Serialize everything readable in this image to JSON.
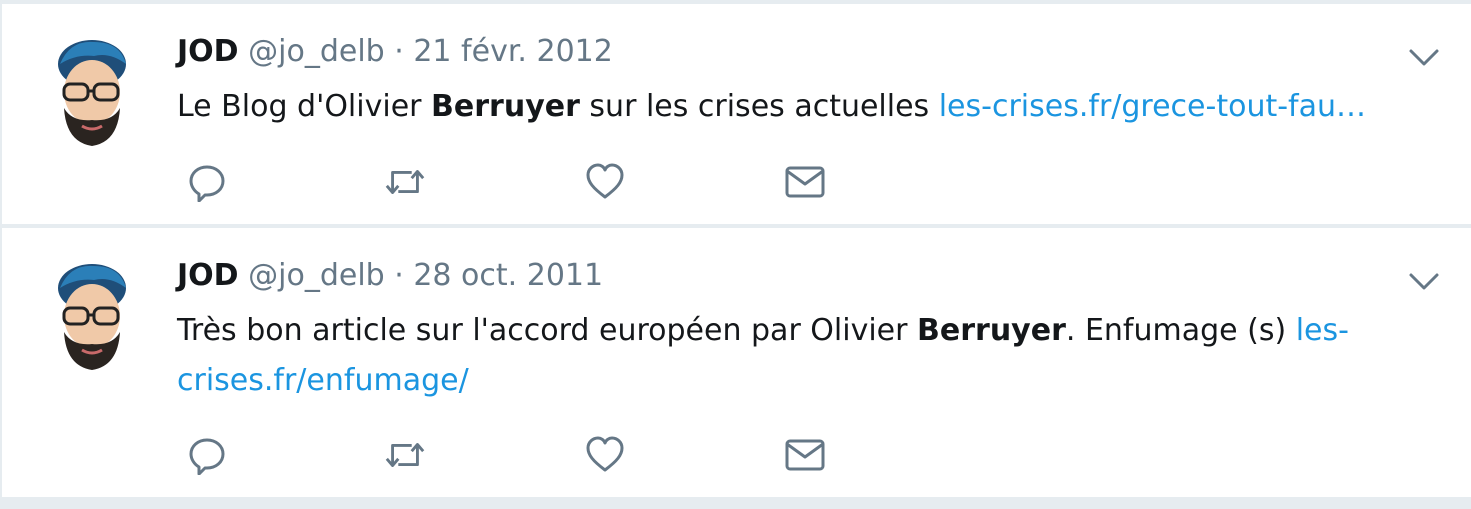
{
  "tweets": [
    {
      "name": "JOD",
      "handle": "@jo_delb",
      "separator": "·",
      "date": "21 févr. 2012",
      "text_before": "Le Blog d'Olivier ",
      "text_bold": "Berruyer",
      "text_after": " sur les crises actuelles ",
      "link": "les-crises.fr/grece-tout-fau…",
      "actions": [
        "reply-icon",
        "retweet-icon",
        "like-icon",
        "direct-message-icon"
      ]
    },
    {
      "name": "JOD",
      "handle": "@jo_delb",
      "separator": "·",
      "date": "28 oct. 2011",
      "text_before": "Très bon article sur l'accord européen par Olivier ",
      "text_bold": "Berruyer",
      "text_after": ".  Enfumage (s) ",
      "link": "les-crises.fr/enfumage/",
      "actions": [
        "reply-icon",
        "retweet-icon",
        "like-icon",
        "direct-message-icon"
      ]
    }
  ],
  "colors": {
    "background": "#e6ecf0",
    "text": "#14171a",
    "muted": "#657786",
    "link": "#1b95e0",
    "icon": "#657786"
  }
}
